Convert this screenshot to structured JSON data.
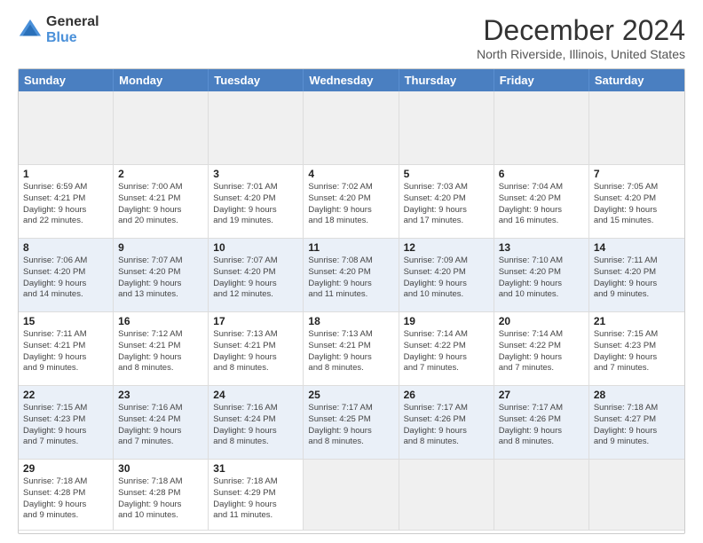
{
  "header": {
    "logo_line1": "General",
    "logo_line2": "Blue",
    "title": "December 2024",
    "subtitle": "North Riverside, Illinois, United States"
  },
  "days": [
    "Sunday",
    "Monday",
    "Tuesday",
    "Wednesday",
    "Thursday",
    "Friday",
    "Saturday"
  ],
  "cells": [
    {
      "day": "",
      "data": "",
      "row": 1
    },
    {
      "day": "",
      "data": "",
      "row": 1
    },
    {
      "day": "",
      "data": "",
      "row": 1
    },
    {
      "day": "",
      "data": "",
      "row": 1
    },
    {
      "day": "",
      "data": "",
      "row": 1
    },
    {
      "day": "",
      "data": "",
      "row": 1
    },
    {
      "day": "",
      "data": "",
      "row": 1
    },
    {
      "day": "1",
      "data": "Sunrise: 6:59 AM\nSunset: 4:21 PM\nDaylight: 9 hours\nand 22 minutes.",
      "row": 1
    },
    {
      "day": "2",
      "data": "Sunrise: 7:00 AM\nSunset: 4:21 PM\nDaylight: 9 hours\nand 20 minutes.",
      "row": 1
    },
    {
      "day": "3",
      "data": "Sunrise: 7:01 AM\nSunset: 4:20 PM\nDaylight: 9 hours\nand 19 minutes.",
      "row": 1
    },
    {
      "day": "4",
      "data": "Sunrise: 7:02 AM\nSunset: 4:20 PM\nDaylight: 9 hours\nand 18 minutes.",
      "row": 1
    },
    {
      "day": "5",
      "data": "Sunrise: 7:03 AM\nSunset: 4:20 PM\nDaylight: 9 hours\nand 17 minutes.",
      "row": 1
    },
    {
      "day": "6",
      "data": "Sunrise: 7:04 AM\nSunset: 4:20 PM\nDaylight: 9 hours\nand 16 minutes.",
      "row": 1
    },
    {
      "day": "7",
      "data": "Sunrise: 7:05 AM\nSunset: 4:20 PM\nDaylight: 9 hours\nand 15 minutes.",
      "row": 1
    },
    {
      "day": "8",
      "data": "Sunrise: 7:06 AM\nSunset: 4:20 PM\nDaylight: 9 hours\nand 14 minutes.",
      "row": 2
    },
    {
      "day": "9",
      "data": "Sunrise: 7:07 AM\nSunset: 4:20 PM\nDaylight: 9 hours\nand 13 minutes.",
      "row": 2
    },
    {
      "day": "10",
      "data": "Sunrise: 7:07 AM\nSunset: 4:20 PM\nDaylight: 9 hours\nand 12 minutes.",
      "row": 2
    },
    {
      "day": "11",
      "data": "Sunrise: 7:08 AM\nSunset: 4:20 PM\nDaylight: 9 hours\nand 11 minutes.",
      "row": 2
    },
    {
      "day": "12",
      "data": "Sunrise: 7:09 AM\nSunset: 4:20 PM\nDaylight: 9 hours\nand 10 minutes.",
      "row": 2
    },
    {
      "day": "13",
      "data": "Sunrise: 7:10 AM\nSunset: 4:20 PM\nDaylight: 9 hours\nand 10 minutes.",
      "row": 2
    },
    {
      "day": "14",
      "data": "Sunrise: 7:11 AM\nSunset: 4:20 PM\nDaylight: 9 hours\nand 9 minutes.",
      "row": 2
    },
    {
      "day": "15",
      "data": "Sunrise: 7:11 AM\nSunset: 4:21 PM\nDaylight: 9 hours\nand 9 minutes.",
      "row": 3
    },
    {
      "day": "16",
      "data": "Sunrise: 7:12 AM\nSunset: 4:21 PM\nDaylight: 9 hours\nand 8 minutes.",
      "row": 3
    },
    {
      "day": "17",
      "data": "Sunrise: 7:13 AM\nSunset: 4:21 PM\nDaylight: 9 hours\nand 8 minutes.",
      "row": 3
    },
    {
      "day": "18",
      "data": "Sunrise: 7:13 AM\nSunset: 4:21 PM\nDaylight: 9 hours\nand 8 minutes.",
      "row": 3
    },
    {
      "day": "19",
      "data": "Sunrise: 7:14 AM\nSunset: 4:22 PM\nDaylight: 9 hours\nand 7 minutes.",
      "row": 3
    },
    {
      "day": "20",
      "data": "Sunrise: 7:14 AM\nSunset: 4:22 PM\nDaylight: 9 hours\nand 7 minutes.",
      "row": 3
    },
    {
      "day": "21",
      "data": "Sunrise: 7:15 AM\nSunset: 4:23 PM\nDaylight: 9 hours\nand 7 minutes.",
      "row": 3
    },
    {
      "day": "22",
      "data": "Sunrise: 7:15 AM\nSunset: 4:23 PM\nDaylight: 9 hours\nand 7 minutes.",
      "row": 4
    },
    {
      "day": "23",
      "data": "Sunrise: 7:16 AM\nSunset: 4:24 PM\nDaylight: 9 hours\nand 7 minutes.",
      "row": 4
    },
    {
      "day": "24",
      "data": "Sunrise: 7:16 AM\nSunset: 4:24 PM\nDaylight: 9 hours\nand 8 minutes.",
      "row": 4
    },
    {
      "day": "25",
      "data": "Sunrise: 7:17 AM\nSunset: 4:25 PM\nDaylight: 9 hours\nand 8 minutes.",
      "row": 4
    },
    {
      "day": "26",
      "data": "Sunrise: 7:17 AM\nSunset: 4:26 PM\nDaylight: 9 hours\nand 8 minutes.",
      "row": 4
    },
    {
      "day": "27",
      "data": "Sunrise: 7:17 AM\nSunset: 4:26 PM\nDaylight: 9 hours\nand 8 minutes.",
      "row": 4
    },
    {
      "day": "28",
      "data": "Sunrise: 7:18 AM\nSunset: 4:27 PM\nDaylight: 9 hours\nand 9 minutes.",
      "row": 4
    },
    {
      "day": "29",
      "data": "Sunrise: 7:18 AM\nSunset: 4:28 PM\nDaylight: 9 hours\nand 9 minutes.",
      "row": 5
    },
    {
      "day": "30",
      "data": "Sunrise: 7:18 AM\nSunset: 4:28 PM\nDaylight: 9 hours\nand 10 minutes.",
      "row": 5
    },
    {
      "day": "31",
      "data": "Sunrise: 7:18 AM\nSunset: 4:29 PM\nDaylight: 9 hours\nand 11 minutes.",
      "row": 5
    },
    {
      "day": "",
      "data": "",
      "row": 5
    },
    {
      "day": "",
      "data": "",
      "row": 5
    },
    {
      "day": "",
      "data": "",
      "row": 5
    },
    {
      "day": "",
      "data": "",
      "row": 5
    }
  ]
}
